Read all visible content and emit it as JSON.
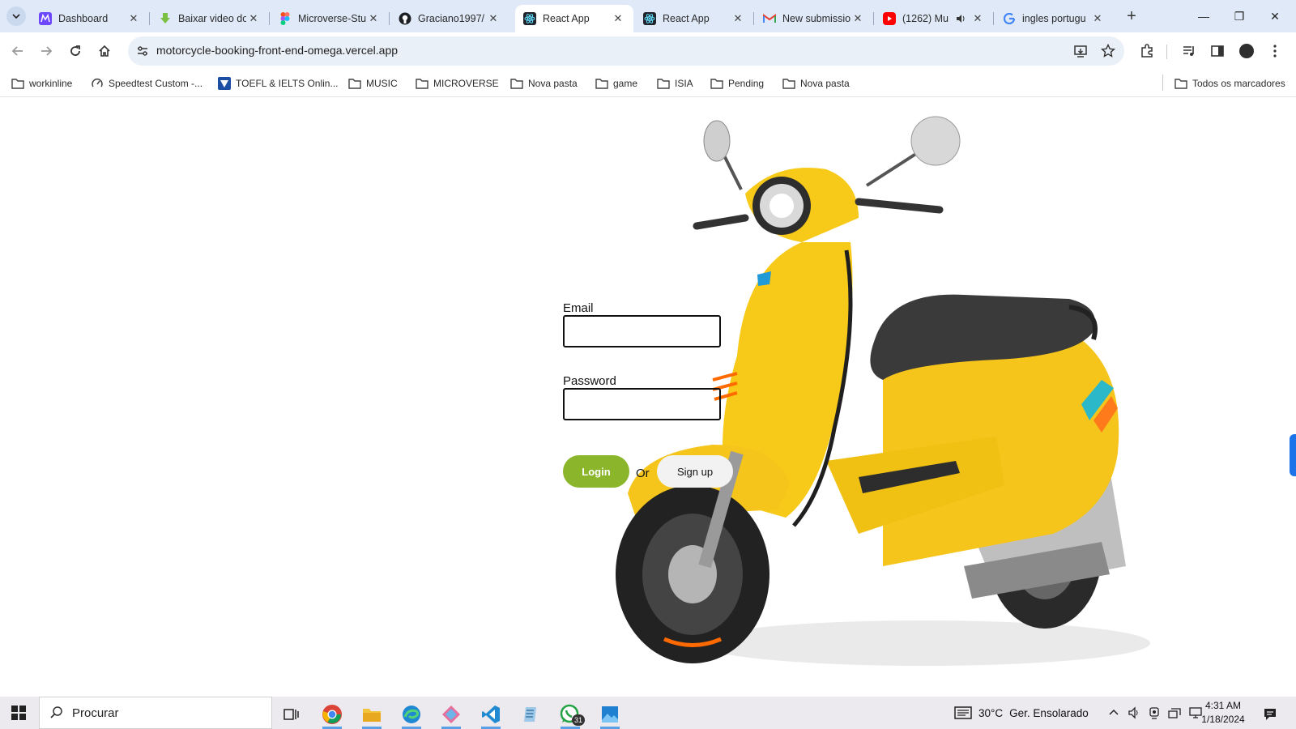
{
  "browser": {
    "tabs": [
      {
        "title": "Dashboard",
        "icon": "dashboard-favicon",
        "active": false
      },
      {
        "title": "Baixar video do",
        "icon": "download-favicon",
        "active": false
      },
      {
        "title": "Microverse-Stu",
        "icon": "figma-favicon",
        "active": false
      },
      {
        "title": "Graciano1997/",
        "icon": "github-favicon",
        "active": false
      },
      {
        "title": "React App",
        "icon": "react-favicon",
        "active": true
      },
      {
        "title": "React App",
        "icon": "react-favicon",
        "active": false
      },
      {
        "title": "New submissio",
        "icon": "gmail-favicon",
        "active": false
      },
      {
        "title": "(1262) Mu",
        "icon": "youtube-favicon",
        "active": false
      },
      {
        "title": "ingles portugu",
        "icon": "google-favicon",
        "active": false
      }
    ],
    "url": "motorcycle-booking-front-end-omega.vercel.app",
    "bookmarks": [
      {
        "label": "workinline",
        "icon": "folder-icon"
      },
      {
        "label": "Speedtest Custom -...",
        "icon": "speedtest-icon"
      },
      {
        "label": "TOEFL & IELTS Onlin...",
        "icon": "toefl-icon"
      },
      {
        "label": "MUSIC",
        "icon": "folder-icon"
      },
      {
        "label": "MICROVERSE",
        "icon": "folder-icon"
      },
      {
        "label": "Nova pasta",
        "icon": "folder-icon"
      },
      {
        "label": "game",
        "icon": "folder-icon"
      },
      {
        "label": "ISIA",
        "icon": "folder-icon"
      },
      {
        "label": "Pending",
        "icon": "folder-icon"
      },
      {
        "label": "Nova pasta",
        "icon": "folder-icon"
      }
    ],
    "all_bookmarks_label": "Todos os marcadores"
  },
  "form": {
    "email_label": "Email",
    "email_value": "",
    "password_label": "Password",
    "password_value": "",
    "login_label": "Login",
    "or_label": "Or",
    "signup_label": "Sign up",
    "accent_color": "#8bb62b"
  },
  "taskbar": {
    "search_placeholder": "Procurar",
    "whatsapp_badge": "31",
    "temperature": "30°C",
    "weather": "Ger. Ensolarado",
    "time": "4:31 AM",
    "date": "1/18/2024"
  }
}
